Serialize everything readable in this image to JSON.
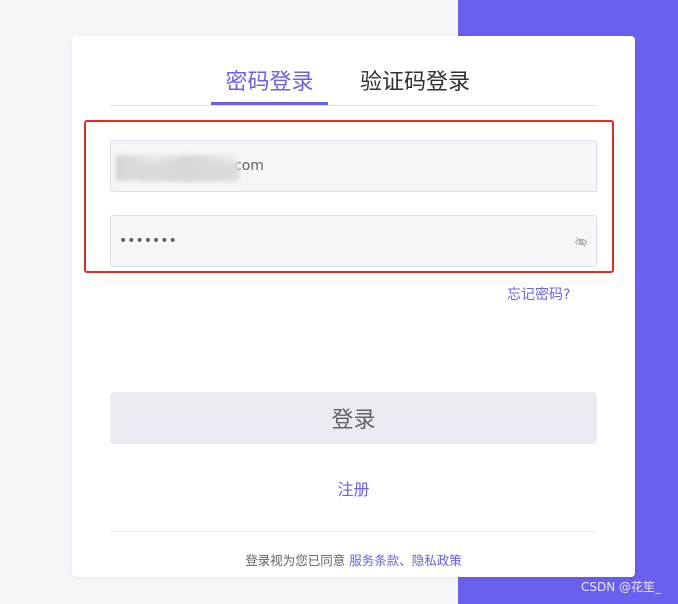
{
  "colors": {
    "accent": "#6960ee",
    "highlight_border": "#e12b2b",
    "page_background": "#f5f6fa"
  },
  "tabs": [
    {
      "label": "密码登录",
      "active": true
    },
    {
      "label": "验证码登录",
      "active": false
    }
  ],
  "form": {
    "username_value": "com",
    "password_value": "1234567",
    "password_icon": "eye-slash-icon"
  },
  "forgot_password": "忘记密码?",
  "login_button": "登录",
  "register_link": "注册",
  "agreement": {
    "prefix": "登录视为您已同意",
    "terms": "服务条款",
    "separator": "、",
    "privacy": "隐私政策"
  },
  "watermark": "CSDN @花笙_"
}
